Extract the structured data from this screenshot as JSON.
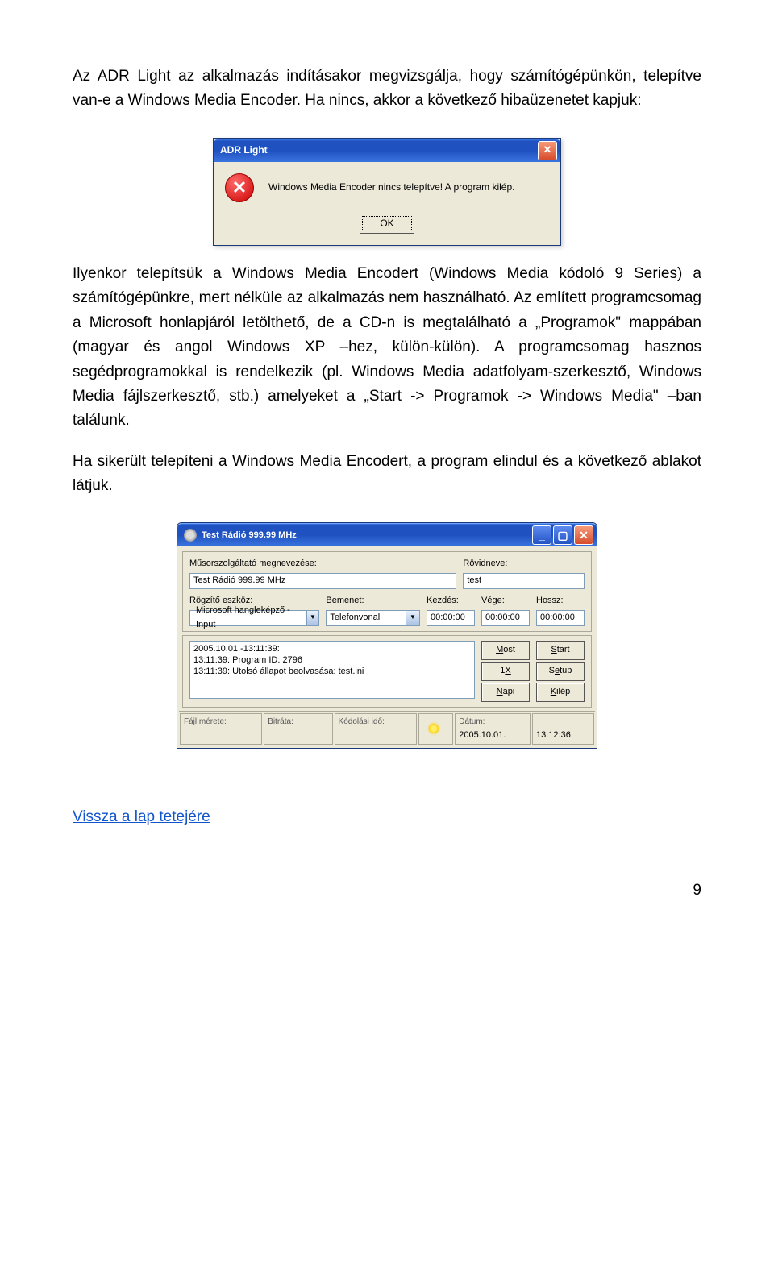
{
  "para1": "Az ADR Light az alkalmazás indításakor megvizsgálja, hogy számítógépünkön, telepítve van-e a Windows Media Encoder. Ha nincs, akkor a következő hibaüzenetet kapjuk:",
  "dialog": {
    "title": "ADR Light",
    "message": "Windows Media Encoder nincs telepítve! A program kilép.",
    "ok": "OK"
  },
  "para2": "Ilyenkor telepítsük a Windows Media Encodert (Windows Media kódoló 9 Series) a számítógépünkre, mert nélküle az alkalmazás nem használható. Az említett programcsomag a Microsoft honlapjáról letölthető, de a CD-n is megtalálható a „Programok\" mappában (magyar és angol Windows XP –hez, külön-külön). A programcsomag hasznos segédprogramokkal is rendelkezik (pl. Windows Media adatfolyam-szerkesztő, Windows Media fájlszerkesztő, stb.) amelyeket a „Start -> Programok -> Windows Media\" –ban találunk.",
  "para3": "Ha sikerült telepíteni a Windows Media Encodert, a program elindul és a következő ablakot látjuk.",
  "app": {
    "title": "Test Rádió 999.99 MHz",
    "labels": {
      "provider": "Műsorszolgáltató megnevezése:",
      "shortname": "Rövidneve:",
      "device": "Rögzítő eszköz:",
      "input": "Bemenet:",
      "start": "Kezdés:",
      "end": "Vége:",
      "length": "Hossz:"
    },
    "values": {
      "provider": "Test Rádió 999.99 MHz",
      "shortname": "test",
      "device": "Microsoft hangleképző - Input",
      "input": "Telefonvonal",
      "start": "00:00:00",
      "end": "00:00:00",
      "length": "00:00:00"
    },
    "log": {
      "l1": "2005.10.01.-13:11:39:",
      "l2": "13:11:39: Program ID: 2796",
      "l3": "13:11:39: Utolsó állapot beolvasása: test.ini"
    },
    "buttons": {
      "most": "Most",
      "start": "Start",
      "oneX": "1X",
      "setup": "Setup",
      "napi": "Napi",
      "exit": "Kilép"
    },
    "status": {
      "filesize_lbl": "Fájl mérete:",
      "bitrate_lbl": "Bitráta:",
      "enctime_lbl": "Kódolási idő:",
      "date_lbl": "Dátum:",
      "date_val": "2005.10.01.",
      "time_val": "13:12:36"
    }
  },
  "link": "Vissza a lap tetejére",
  "page_num": "9"
}
